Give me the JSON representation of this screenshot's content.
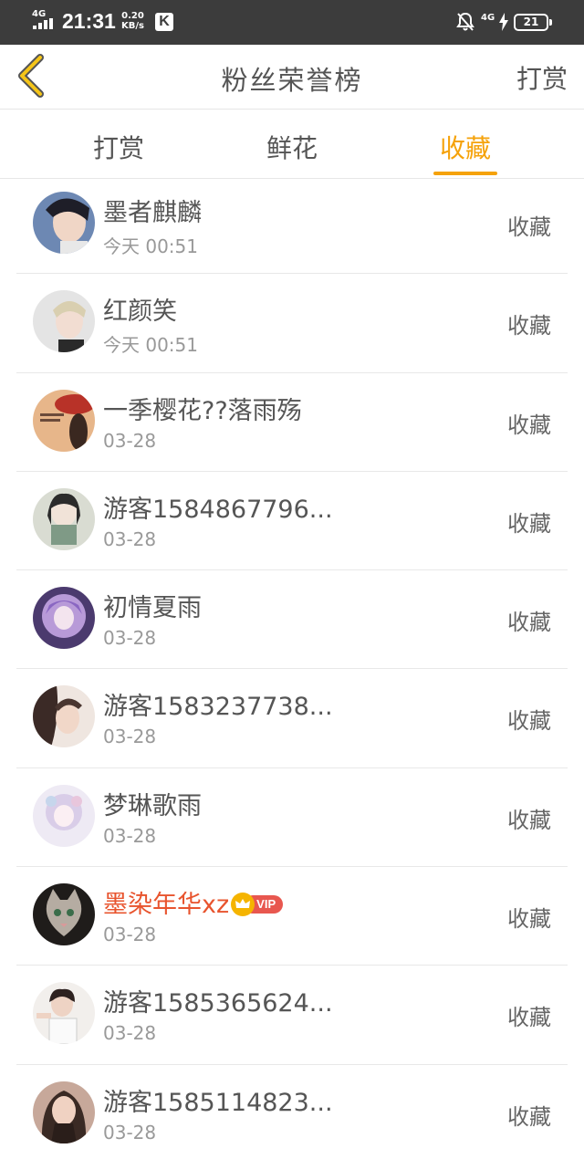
{
  "status_bar": {
    "network": "4G",
    "time": "21:31",
    "speed_value": "0.20",
    "speed_unit": "KB/s",
    "app_icon_letter": "K",
    "network_right": "4G",
    "battery": "21"
  },
  "header": {
    "title": "粉丝荣誉榜",
    "action_label": "打赏"
  },
  "tabs": [
    {
      "label": "打赏",
      "active": false
    },
    {
      "label": "鲜花",
      "active": false
    },
    {
      "label": "收藏",
      "active": true
    }
  ],
  "colors": {
    "accent": "#f5a20a",
    "vip_name": "#e8542e",
    "vip_badge": "#e8574f"
  },
  "fans": [
    {
      "name": "墨者麒麟",
      "date": "今天 00:51",
      "action": "收藏",
      "vip": false,
      "vip_label": ""
    },
    {
      "name": "红颜笑",
      "date": "今天 00:51",
      "action": "收藏",
      "vip": false,
      "vip_label": ""
    },
    {
      "name": "一季樱花??落雨殇",
      "date": "03-28",
      "action": "收藏",
      "vip": false,
      "vip_label": ""
    },
    {
      "name": "游客1584867796...",
      "date": "03-28",
      "action": "收藏",
      "vip": false,
      "vip_label": ""
    },
    {
      "name": "初情夏雨",
      "date": "03-28",
      "action": "收藏",
      "vip": false,
      "vip_label": ""
    },
    {
      "name": "游客1583237738...",
      "date": "03-28",
      "action": "收藏",
      "vip": false,
      "vip_label": ""
    },
    {
      "name": "梦琳歌雨",
      "date": "03-28",
      "action": "收藏",
      "vip": false,
      "vip_label": ""
    },
    {
      "name": "墨染年华xz",
      "date": "03-28",
      "action": "收藏",
      "vip": true,
      "vip_label": "VIP"
    },
    {
      "name": "游客1585365624...",
      "date": "03-28",
      "action": "收藏",
      "vip": false,
      "vip_label": ""
    },
    {
      "name": "游客1585114823...",
      "date": "03-28",
      "action": "收藏",
      "vip": false,
      "vip_label": ""
    }
  ]
}
